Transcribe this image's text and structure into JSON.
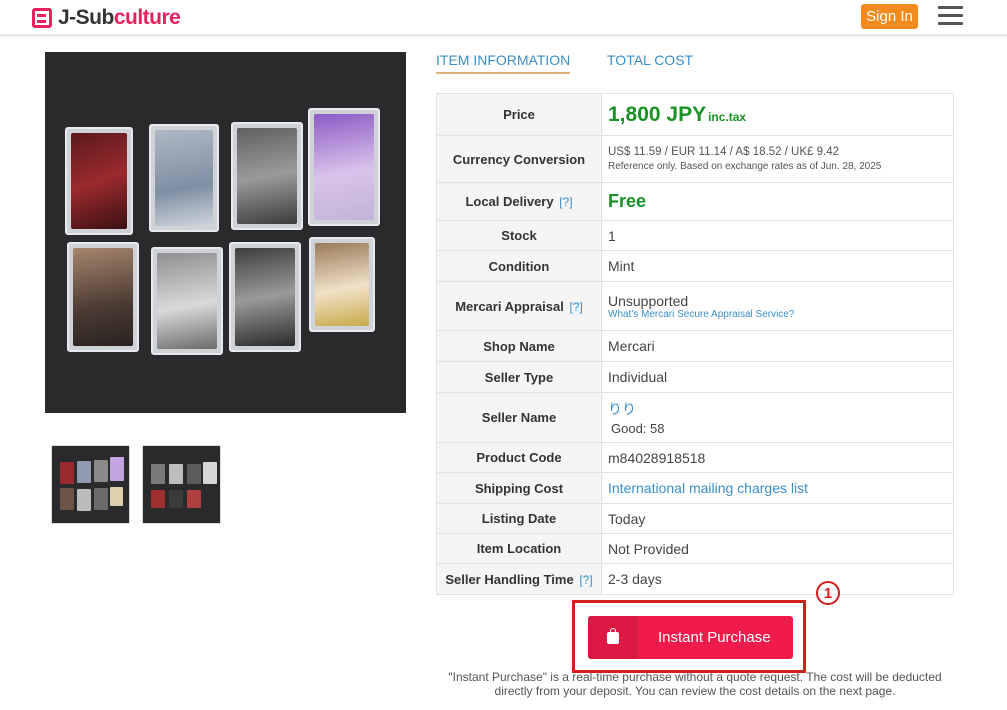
{
  "header": {
    "logo_prefix": "J-Sub",
    "logo_accent": "culture",
    "signin_label": "Sign In",
    "brand_color": "#e8215d"
  },
  "gallery": {
    "main_alt": "8 photocards on black fabric",
    "thumbnails": 2
  },
  "tabs": [
    {
      "label": "ITEM INFORMATION",
      "active": true
    },
    {
      "label": "TOTAL COST",
      "active": false
    }
  ],
  "info": {
    "price": {
      "label": "Price",
      "value": "1,800 JPY",
      "suffix": "inc.tax"
    },
    "currency": {
      "label": "Currency Conversion",
      "value": "US$ 11.59 /  EUR 11.14 /  A$ 18.52 /  UK£ 9.42",
      "note": "Reference only. Based on exchange rates as of Jun. 28, 2025"
    },
    "delivery": {
      "label": "Local Delivery",
      "help": "[?]",
      "value": "Free"
    },
    "stock": {
      "label": "Stock",
      "value": "1"
    },
    "condition": {
      "label": "Condition",
      "value": "Mint"
    },
    "appraisal": {
      "label": "Mercari Appraisal",
      "help": "[?]",
      "value": "Unsupported",
      "link": "What's Mercari Secure Appraisal Service?"
    },
    "shop": {
      "label": "Shop Name",
      "value": "Mercari"
    },
    "seller_type": {
      "label": "Seller Type",
      "value": "Individual"
    },
    "seller_name": {
      "label": "Seller Name",
      "value": "りり",
      "rating_label": "Good:",
      "rating": "58"
    },
    "product_code": {
      "label": "Product Code",
      "value": "m84028918518"
    },
    "shipping": {
      "label": "Shipping Cost",
      "value": "International mailing charges list"
    },
    "listing_date": {
      "label": "Listing Date",
      "value": "Today"
    },
    "location": {
      "label": "Item Location",
      "value": "Not Provided"
    },
    "handling": {
      "label": "Seller Handling Time",
      "help": "[?]",
      "value": "2-3 days"
    }
  },
  "purchase": {
    "button_label": "Instant Purchase",
    "badge": "1",
    "note": "\"Instant Purchase\" is a real-time purchase without a quote request. The cost will be deducted directly from your deposit. You can review the cost details on the next page."
  }
}
